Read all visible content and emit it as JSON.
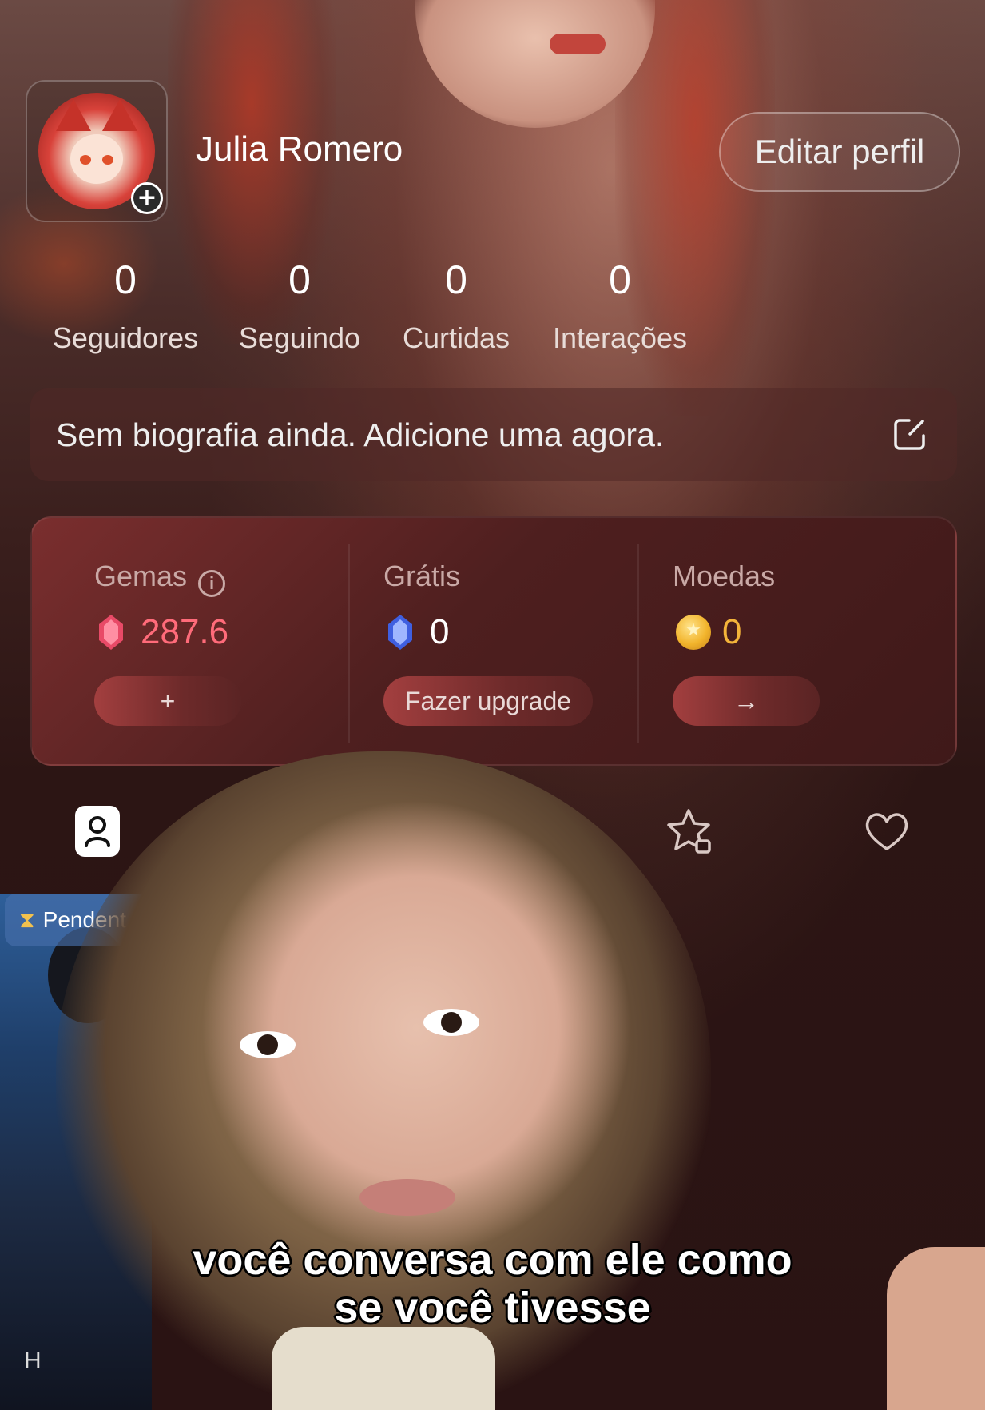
{
  "profile": {
    "name": "Julia Romero",
    "edit_label": "Editar perfil",
    "avatar_add_icon": "+"
  },
  "stats": [
    {
      "value": "0",
      "label": "Seguidores"
    },
    {
      "value": "0",
      "label": "Seguindo"
    },
    {
      "value": "0",
      "label": "Curtidas"
    },
    {
      "value": "0",
      "label": "Interações"
    }
  ],
  "bio": {
    "text": "Sem biografia ainda. Adicione uma agora.",
    "edit_icon": "edit-square-icon"
  },
  "wallet": {
    "gems": {
      "title": "Gemas",
      "info": "i",
      "value": "287.6",
      "button": "+",
      "color": "#ff6b7a"
    },
    "free": {
      "title": "Grátis",
      "value": "0",
      "button": "Fazer upgrade"
    },
    "coins": {
      "title": "Moedas",
      "value": "0",
      "button": "→",
      "color": "#f4b43a"
    }
  },
  "tabs": [
    {
      "icon": "person-icon",
      "active": true
    },
    {
      "icon": "id-card-lock-icon"
    },
    {
      "icon": "star-lock-icon"
    },
    {
      "icon": "heart-icon"
    }
  ],
  "card": {
    "badge": "Pendent",
    "bottom_text": "H"
  },
  "subtitle": {
    "line1": "você conversa com ele como",
    "line2": "se você tivesse"
  }
}
